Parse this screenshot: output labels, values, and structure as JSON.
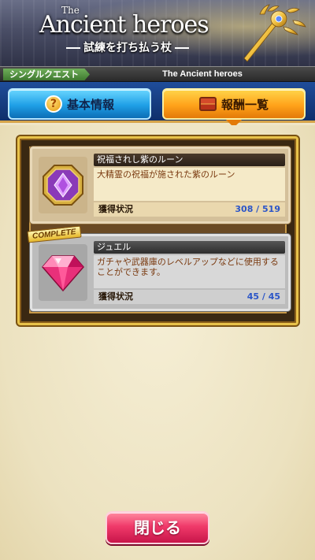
{
  "banner": {
    "title_small": "The",
    "title": "Ancient heroes",
    "subtitle": "試練を打ち払う杖"
  },
  "breadcrumb": {
    "mode": "シングルクエスト",
    "quest": "The Ancient heroes"
  },
  "tabs": [
    {
      "label": "基本情報",
      "icon": "question-icon",
      "active": false
    },
    {
      "label": "報酬一覧",
      "icon": "treasure-chest-icon",
      "active": true
    }
  ],
  "rewards": [
    {
      "name": "祝福されし紫のルーン",
      "description": "大精霊の祝福が施された紫のルーン",
      "status_label": "獲得状況",
      "status_value": "308 / 519",
      "icon": "purple-rune-icon",
      "complete": false
    },
    {
      "name": "ジュエル",
      "description": "ガチャや武器庫のレベルアップなどに使用することができます。",
      "status_label": "獲得状況",
      "status_value": "45 / 45",
      "icon": "jewel-icon",
      "complete": true,
      "badge": "COMPLETE"
    }
  ],
  "close_button": {
    "label": "閉じる"
  },
  "colors": {
    "tab_active": "#ffa21a",
    "tab_inactive": "#1f9fe6",
    "close_button": "#f03a6a",
    "status_value": "#2b55c8",
    "panel_border": "#e8c24a"
  }
}
